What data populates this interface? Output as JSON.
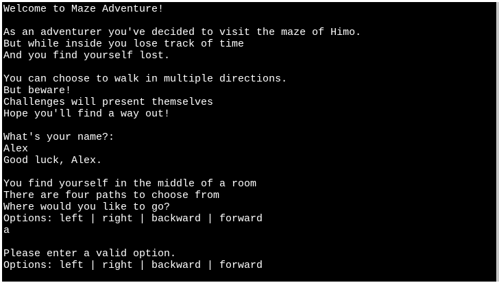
{
  "terminal": {
    "background": "#000000",
    "foreground": "#ffffff",
    "lines": [
      "Welcome to Maze Adventure!",
      "",
      "As an adventurer you've decided to visit the maze of Himo.",
      "But while inside you lose track of time",
      "And you find yourself lost.",
      "",
      "You can choose to walk in multiple directions.",
      "But beware!",
      "Challenges will present themselves",
      "Hope you'll find a way out!",
      "",
      "What's your name?:",
      "Alex",
      "Good luck, Alex.",
      "",
      "You find yourself in the middle of a room",
      "There are four paths to choose from",
      "Where would you like to go?",
      "Options: left | right | backward | forward",
      "a",
      "",
      "Please enter a valid option.",
      "Options: left | right | backward | forward"
    ]
  }
}
